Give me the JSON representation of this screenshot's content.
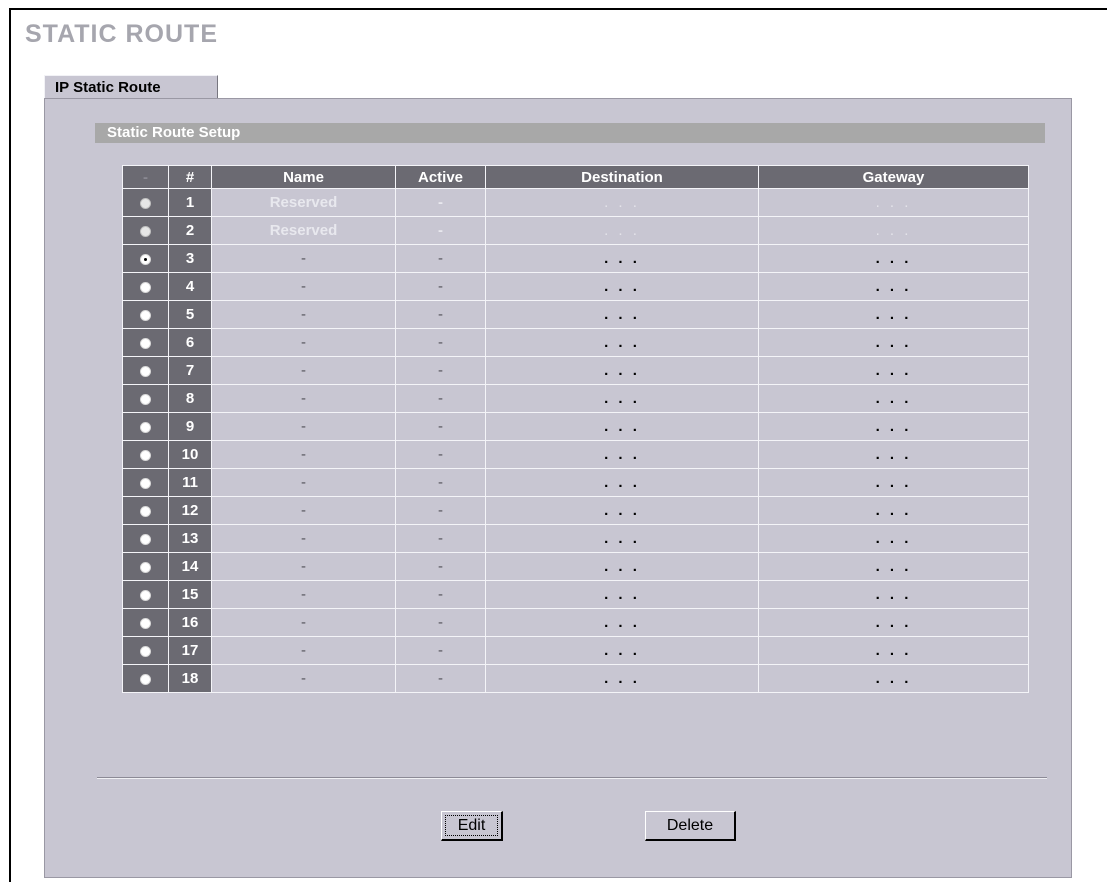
{
  "page": {
    "title": "STATIC ROUTE"
  },
  "tabs": [
    {
      "label": "IP Static Route"
    }
  ],
  "section": {
    "title": "Static Route Setup"
  },
  "table": {
    "columns": [
      "-",
      "#",
      "Name",
      "Active",
      "Destination",
      "Gateway"
    ],
    "rows": [
      {
        "index": "1",
        "name": "Reserved",
        "active": "-",
        "destination": ". . .",
        "gateway": ". . .",
        "selected": false,
        "reserved": true
      },
      {
        "index": "2",
        "name": "Reserved",
        "active": "-",
        "destination": ". . .",
        "gateway": ". . .",
        "selected": false,
        "reserved": true
      },
      {
        "index": "3",
        "name": "-",
        "active": "-",
        "destination": ". . .",
        "gateway": ". . .",
        "selected": true,
        "reserved": false
      },
      {
        "index": "4",
        "name": "-",
        "active": "-",
        "destination": ". . .",
        "gateway": ". . .",
        "selected": false,
        "reserved": false
      },
      {
        "index": "5",
        "name": "-",
        "active": "-",
        "destination": ". . .",
        "gateway": ". . .",
        "selected": false,
        "reserved": false
      },
      {
        "index": "6",
        "name": "-",
        "active": "-",
        "destination": ". . .",
        "gateway": ". . .",
        "selected": false,
        "reserved": false
      },
      {
        "index": "7",
        "name": "-",
        "active": "-",
        "destination": ". . .",
        "gateway": ". . .",
        "selected": false,
        "reserved": false
      },
      {
        "index": "8",
        "name": "-",
        "active": "-",
        "destination": ". . .",
        "gateway": ". . .",
        "selected": false,
        "reserved": false
      },
      {
        "index": "9",
        "name": "-",
        "active": "-",
        "destination": ". . .",
        "gateway": ". . .",
        "selected": false,
        "reserved": false
      },
      {
        "index": "10",
        "name": "-",
        "active": "-",
        "destination": ". . .",
        "gateway": ". . .",
        "selected": false,
        "reserved": false
      },
      {
        "index": "11",
        "name": "-",
        "active": "-",
        "destination": ". . .",
        "gateway": ". . .",
        "selected": false,
        "reserved": false
      },
      {
        "index": "12",
        "name": "-",
        "active": "-",
        "destination": ". . .",
        "gateway": ". . .",
        "selected": false,
        "reserved": false
      },
      {
        "index": "13",
        "name": "-",
        "active": "-",
        "destination": ". . .",
        "gateway": ". . .",
        "selected": false,
        "reserved": false
      },
      {
        "index": "14",
        "name": "-",
        "active": "-",
        "destination": ". . .",
        "gateway": ". . .",
        "selected": false,
        "reserved": false
      },
      {
        "index": "15",
        "name": "-",
        "active": "-",
        "destination": ". . .",
        "gateway": ". . .",
        "selected": false,
        "reserved": false
      },
      {
        "index": "16",
        "name": "-",
        "active": "-",
        "destination": ". . .",
        "gateway": ". . .",
        "selected": false,
        "reserved": false
      },
      {
        "index": "17",
        "name": "-",
        "active": "-",
        "destination": ". . .",
        "gateway": ". . .",
        "selected": false,
        "reserved": false
      },
      {
        "index": "18",
        "name": "-",
        "active": "-",
        "destination": ". . .",
        "gateway": ". . .",
        "selected": false,
        "reserved": false
      }
    ]
  },
  "buttons": {
    "edit": "Edit",
    "delete": "Delete"
  },
  "colors": {
    "panel": "#c8c6d2",
    "header": "#6b6a72",
    "section_bar": "#a8a8a8",
    "title": "#a6a6ae"
  }
}
